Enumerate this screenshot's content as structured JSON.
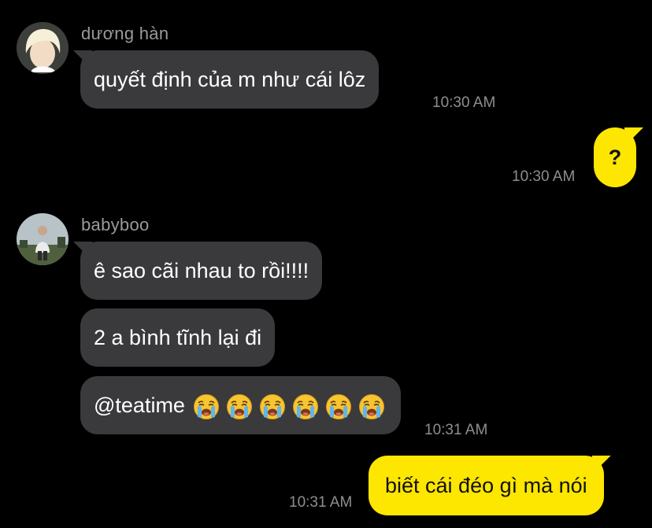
{
  "messages": {
    "m1": {
      "sender": "dương hàn",
      "text": "quyết định của m như cái lôz",
      "time": "10:30 AM"
    },
    "m2": {
      "text": "?",
      "time": "10:30 AM"
    },
    "m3": {
      "sender": "babyboo",
      "text": "ê sao cãi nhau to rồi!!!!",
      "time": ""
    },
    "m4": {
      "text": "2 a bình tĩnh lại đi"
    },
    "m5": {
      "text": "@teatime",
      "emoji_count": 6,
      "emoji": "loudly-crying-face-icon",
      "time": "10:31 AM"
    },
    "m6": {
      "text": "biết cái đéo gì mà nói",
      "time": "10:31 AM"
    }
  },
  "colors": {
    "background": "#000000",
    "incoming_bubble": "#3a3a3c",
    "outgoing_bubble": "#fde600",
    "sender_name": "#9a9a9a",
    "timestamp": "#8e8e8e"
  }
}
